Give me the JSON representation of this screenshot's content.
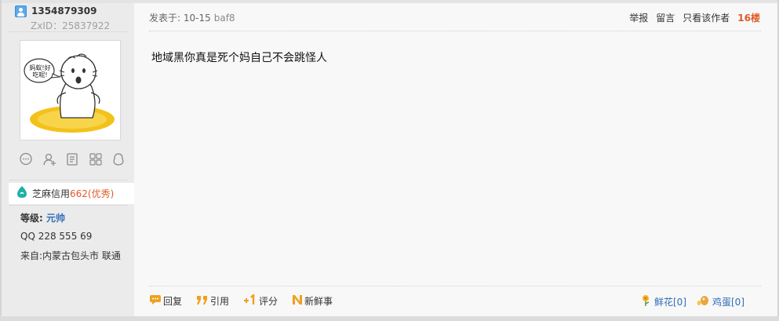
{
  "user": {
    "name": "1354879309",
    "zxid": "ZxID：25837922",
    "avatar_text": "蚂蚁!好吃呢!",
    "credit_label": "芝麻信用",
    "credit_score": "662(优秀)",
    "level_label": "等级:",
    "level_value": "元帅",
    "qq": "QQ 228 555 69",
    "location": "来自:内蒙古包头市 联通"
  },
  "sidebar_icons": [
    "message-icon",
    "add-friend-icon",
    "document-icon",
    "apps-icon",
    "penguin-icon"
  ],
  "post": {
    "published": "发表于: 10-15",
    "hash": "baf8",
    "report": "举报",
    "comment": "留言",
    "only_author": "只看该作者",
    "floor": "16楼",
    "content": "地域黑你真是死个妈自己不会跳怪人"
  },
  "footer": {
    "reply": "回复",
    "quote": "引用",
    "rate": "评分",
    "news": "新鲜事",
    "flower": "鲜花[0]",
    "egg": "鸡蛋[0]"
  },
  "colors": {
    "sidebar_bg": "#ebebeb",
    "main_bg": "#f8f8f8",
    "floor_color": "#e05a2a",
    "link_blue": "#2f6db8",
    "accent_orange": "#f0a020"
  }
}
